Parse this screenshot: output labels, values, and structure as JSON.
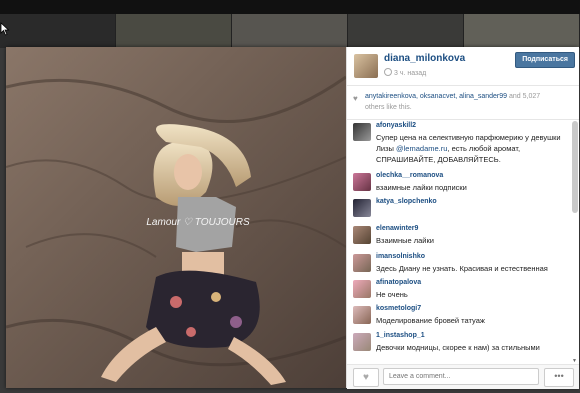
{
  "post": {
    "username": "diana_milonkova",
    "time": "3 ч. назад",
    "follow_label": "Подписаться",
    "likes_names": "anytakireenkova, oksanacvet, alina_sander99",
    "likes_and": "and",
    "likes_count": "5,027",
    "likes_suffix": "others like this.",
    "shirt_text": "Lamour ♡ TOUJOURS"
  },
  "comments": [
    {
      "user": "afonyaskill2",
      "text": "Супер цена на селективную парфюмерию у девушки Лизы ",
      "mention": "@lemadame.ru",
      "text2": ", есть любой аромат, СПРАШИВАЙТЕ, ДОБАВЛЯЙТЕСЬ."
    },
    {
      "user": "olechka__romanova",
      "text": "взаимные лайки подписки"
    },
    {
      "user": "katya_slopchenko",
      "text": ""
    },
    {
      "user": "elenawinter9",
      "text": "Взаимные лайки"
    },
    {
      "user": "imansolnishko",
      "text": "Здесь Диану не узнать. Красивая и естественная"
    },
    {
      "user": "afinatopalova",
      "text": "Не очень"
    },
    {
      "user": "kosmetologi7",
      "text": "Моделирование бровей татуаж"
    },
    {
      "user": "1_instashop_1",
      "text": "Девочки модницы, скорее к нам) за стильными"
    }
  ],
  "footer": {
    "comment_placeholder": "Leave a comment...",
    "more_label": "•••"
  }
}
